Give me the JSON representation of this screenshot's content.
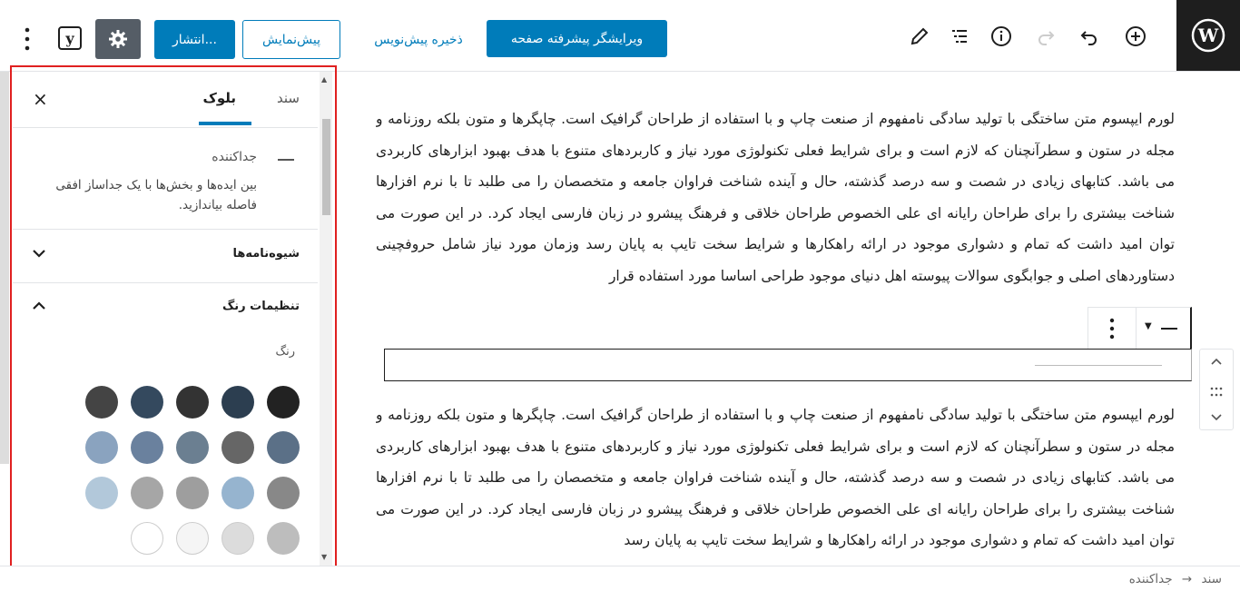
{
  "toolbar": {
    "add_block_icon": "plus-circle-icon",
    "undo_icon": "undo-icon",
    "redo_icon": "redo-icon",
    "info_icon": "info-icon",
    "outline_icon": "list-view-icon",
    "edit_icon": "pencil-icon",
    "advanced_editor_label": "ویرایشگر پیشرفته صفحه",
    "save_draft_label": "ذخیره پیش‌نویس",
    "preview_label": "پیش‌نمایش",
    "publish_label": "انتشار...",
    "settings_icon": "gear-icon",
    "yoast_label": "y",
    "more_icon": "vertical-ellipsis-icon"
  },
  "sidebar": {
    "tab_document": "سند",
    "tab_block": "بلوک",
    "close_label": "×",
    "block_name": "جداکننده",
    "block_description": "بین ایده‌ها و بخش‌ها با یک جداساز افقی فاصله بیاندازید.",
    "panel_styles": "شیوه‌نامه‌ها",
    "panel_color": "تنظیمات رنگ",
    "color_label": "رنگ",
    "swatches": [
      "#222222",
      "#2c3e50",
      "#333333",
      "#34495e",
      "#444444",
      "#5b7087",
      "#666666",
      "#6b7f91",
      "#6a819e",
      "#8aa3bf",
      "#888888",
      "#96b4cf",
      "#9e9e9e",
      "#a6a6a6",
      "#b2c8da",
      "#bdbdbd",
      "#dcdcdc",
      "#f5f5f5",
      "#ffffff"
    ]
  },
  "content": {
    "paragraph1": "لورم ایپسوم متن ساختگی با تولید سادگی نامفهوم از صنعت چاپ و با استفاده از طراحان گرافیک است. چاپگرها و متون بلکه روزنامه و مجله در ستون و سطرآنچنان که لازم است و برای شرایط فعلی تکنولوژی مورد نیاز و کاربردهای متنوع با هدف بهبود ابزارهای کاربردی می باشد. کتابهای زیادی در شصت و سه درصد گذشته، حال و آینده شناخت فراوان جامعه و متخصصان را می طلبد تا با نرم افزارها شناخت بیشتری را برای طراحان رایانه ای علی الخصوص طراحان خلاقی و فرهنگ پیشرو در زبان فارسی ایجاد کرد. در این صورت می توان امید داشت که تمام و دشواری موجود در ارائه راهکارها و شرایط سخت تایپ به پایان رسد وزمان مورد نیاز شامل حروفچینی دستاوردهای اصلی و جوابگوی سوالات پیوسته اهل دنیای موجود طراحی اساسا مورد استفاده قرار",
    "paragraph2": "لورم ایپسوم متن ساختگی با تولید سادگی نامفهوم از صنعت چاپ و با استفاده از طراحان گرافیک است. چاپگرها و متون بلکه روزنامه و مجله در ستون و سطرآنچنان که لازم است و برای شرایط فعلی تکنولوژی مورد نیاز و کاربردهای متنوع با هدف بهبود ابزارهای کاربردی می باشد. کتابهای زیادی در شصت و سه درصد گذشته، حال و آینده شناخت فراوان جامعه و متخصصان را می طلبد تا با نرم افزارها شناخت بیشتری را برای طراحان رایانه ای علی الخصوص طراحان خلاقی و فرهنگ پیشرو در زبان فارسی ایجاد کرد. در این صورت می توان امید داشت که تمام و دشواری موجود در ارائه راهکارها و شرایط سخت تایپ به پایان رسد"
  },
  "footer": {
    "breadcrumb_root": "سند",
    "breadcrumb_arrow": "→",
    "breadcrumb_current": "جداکننده"
  }
}
